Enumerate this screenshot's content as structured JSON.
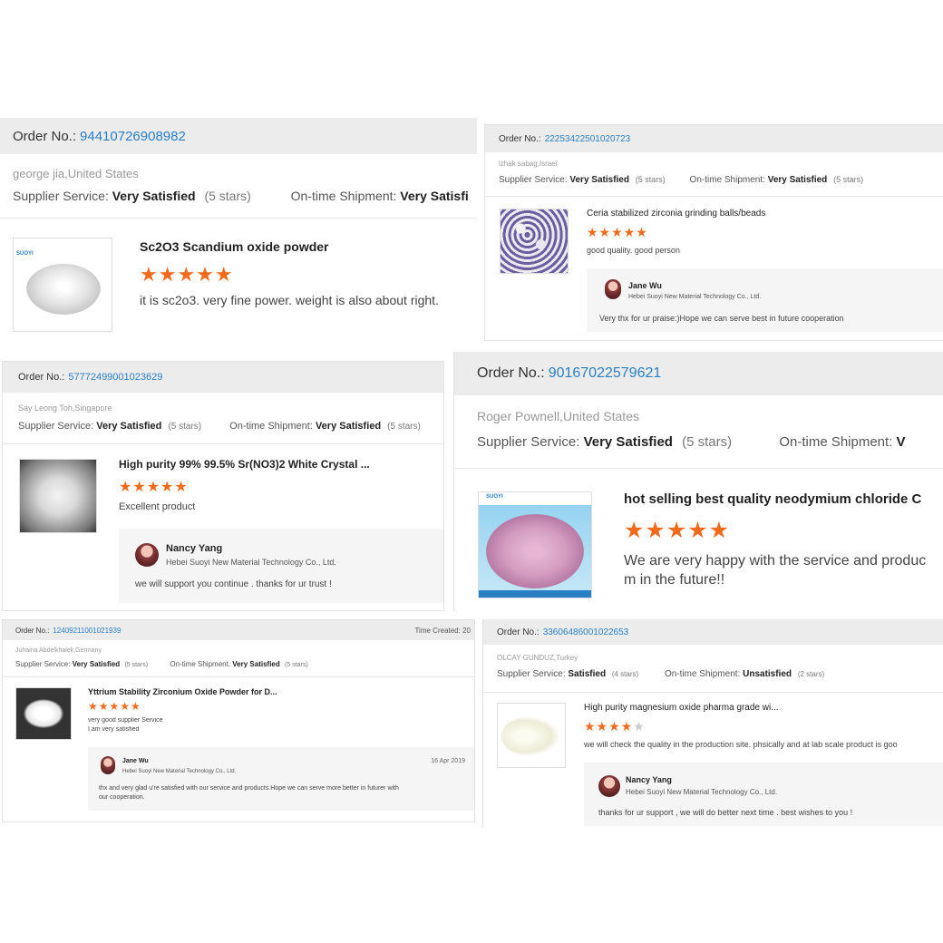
{
  "labels": {
    "order_no": "Order No.:",
    "supplier_service": "Supplier Service:",
    "ontime_shipment": "On-time Shipment:",
    "time_created": "Time Created:"
  },
  "reviews": [
    {
      "order_number": "94410726908982",
      "buyer": "george jia,United States",
      "supplier_rating": "Very Satisfied",
      "supplier_stars": "(5 stars)",
      "shipment_rating": "Very Satisfi",
      "product_title": "Sc2O3 Scandium oxide powder",
      "stars": 5,
      "comment": "it is sc2o3. very fine power. weight is also about right."
    },
    {
      "order_number": "22253422501020723",
      "buyer": "izhak sabag,Israel",
      "supplier_rating": "Very Satisfied",
      "supplier_stars": "(5 stars)",
      "shipment_rating": "Very Satisfied",
      "shipment_stars": "(5 stars)",
      "product_title": "Ceria stabilized zirconia grinding balls/beads",
      "stars": 5,
      "comment": "good quality. good person",
      "reply": {
        "name": "Jane Wu",
        "company": "Hebei Suoyi New Material Technology Co., Ltd.",
        "text": "Very thx for ur praise:)Hope we can serve best in future cooperation"
      }
    },
    {
      "order_number": "57772499001023629",
      "buyer": "Say Leong Toh,Singapore",
      "supplier_rating": "Very Satisfied",
      "supplier_stars": "(5 stars)",
      "shipment_rating": "Very Satisfied",
      "shipment_stars": "(5 stars)",
      "product_title": "High purity 99% 99.5% Sr(NO3)2 White Crystal ...",
      "stars": 5,
      "comment": "Excellent product",
      "reply": {
        "name": "Nancy Yang",
        "company": "Hebei Suoyi New Material Technology Co., Ltd.",
        "text": "we will support you continue . thanks for ur trust !"
      }
    },
    {
      "order_number": "90167022579621",
      "buyer": "Roger Pownell,United States",
      "supplier_rating": "Very Satisfied",
      "supplier_stars": "(5 stars)",
      "shipment_rating": "V",
      "product_title": "hot selling best quality neodymium chloride C",
      "stars": 5,
      "comment": "We are very happy with the service and produc",
      "comment2": "m in the future!!"
    },
    {
      "order_number": "12409211001021939",
      "time_created": "20",
      "buyer": "Juhaina Abdelkhalek,Germany",
      "supplier_rating": "Very Satisfied",
      "supplier_stars": "(5 stars)",
      "shipment_rating": "Very Satisfied",
      "shipment_stars": "(5 stars)",
      "product_title": "Yttrium Stability Zirconium Oxide Powder for D...",
      "stars": 5,
      "comment": "very good supplier Service",
      "comment2": "I am very satisfied",
      "reply": {
        "name": "Jane Wu",
        "company": "Hebei Suoyi New Material Technology Co., Ltd.",
        "date": "16 Apr 2019",
        "text": "thx and very glad u're satisfied with our service and products.Hope we can serve more better in futurer with",
        "text2": "our cooperation."
      }
    },
    {
      "order_number": "33606486001022653",
      "buyer": "OLCAY GUNDUZ,Turkey",
      "supplier_rating": "Satisfied",
      "supplier_stars": "(4 stars)",
      "shipment_rating": "Unsatisfied",
      "shipment_stars": "(2 stars)",
      "product_title": "High purity magnesium oxide pharma grade wi...",
      "stars": 4,
      "comment": "we will check the quality in the production site. phsically and at lab scale product is goo",
      "reply": {
        "name": "Nancy Yang",
        "company": "Hebei Suoyi New Material Technology Co., Ltd.",
        "text": "thanks for ur support , we will do better next time . best wishes to you !"
      }
    }
  ],
  "thumb_logo": "SUOYI",
  "colors": {
    "link": "#2a7fc4",
    "star": "#f26b1d",
    "header_bg": "#ececec",
    "reply_bg": "#f5f5f5"
  }
}
